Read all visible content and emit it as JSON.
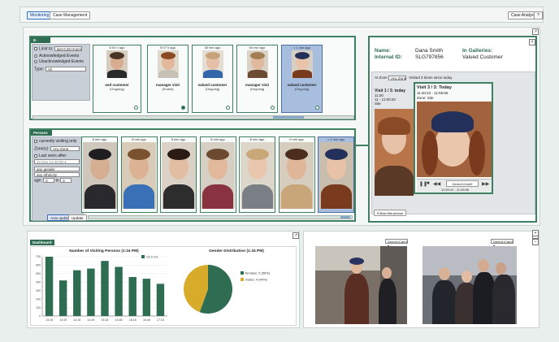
{
  "tabs": [
    {
      "label": "Monitoring"
    },
    {
      "label": "Case Management"
    }
  ],
  "top_right": {
    "case_analysis_label": "Case Analysis...",
    "help_label": "?"
  },
  "events": {
    "title": "E-Events",
    "limit_label": "Limit to:",
    "limit_value": "last 0.25 Hours",
    "filter_options": [
      "Acknowledged Events",
      "Unacknowledged Events"
    ],
    "type_label": "Type:",
    "type_value": "All",
    "cards": [
      {
        "time": "5:04 h ago",
        "label": "ued customer",
        "sub": "(Ongoing)"
      },
      {
        "time": "5:07 h ago",
        "label": "manager visit",
        "sub": "(Ended)"
      },
      {
        "time": "40 min ago",
        "label": "valued customer",
        "sub": "(Ongoing)"
      },
      {
        "time": "60 min ago",
        "label": "manager visit",
        "sub": "(Ongoing)"
      },
      {
        "time": "< 1 min ago",
        "label": "valued customer",
        "sub": "(Ongoing)"
      }
    ]
  },
  "persons": {
    "title": "Persons",
    "currently_visiting": "currently visiting only",
    "zones_label": "Zone(s):",
    "zones_value": "Any Zone",
    "last_seen_label": "Last seen after:",
    "date_value": "22 Nov 13 00:00 ▾",
    "gender_value": "any gender",
    "ethnicity_value": "any ethnicity",
    "age_label": "age:",
    "age_from": "0",
    "age_to_label": "to",
    "age_to": "0",
    "auto_update_label": "Auto update",
    "update_label": "Update",
    "cards": [
      {
        "time": "8 min ago"
      },
      {
        "time": "8 min ago"
      },
      {
        "time": "8 min ago"
      },
      {
        "time": "8 min ago"
      },
      {
        "time": "8 min ago"
      },
      {
        "time": "9 min ago"
      },
      {
        "time": "< 1 min ago"
      }
    ]
  },
  "detail": {
    "name_label": "Name:",
    "name_value": "Dana Smith",
    "id_label": "Internal ID:",
    "id_value": "SLG797856",
    "galleries_label": "In Galleries:",
    "galleries_value": "Valued Customer",
    "at_zone_label": "At Zone",
    "zone_value": "Any Zone",
    "visited_text": "Visited 3 times since today",
    "visit_title": "Visit 1 / 3: today",
    "visit_time": "11:00",
    "visit_range": "11 - 11:00:20",
    "visit_zone": "Site",
    "popup_title": "Visit 3 / 3: Today",
    "popup_time": "11:40:23 - 11:55:56",
    "popup_zone": "Zone: Site",
    "player_label": "Demo1\\Cam0",
    "player_time": "11:55:10 - 11:55:56",
    "follow_label": "Follow this person"
  },
  "dashboard": {
    "title": "Dashboard",
    "chart1_title": "Number of Visiting Persons (1:34 PM)",
    "chart2_title": "Gender Distribution (1:34 PM)",
    "bar_legend": "1/1:1+1/1"
  },
  "chart_data": [
    {
      "type": "bar",
      "title": "Number of Visiting Persons (1:34 PM)",
      "categories": [
        "13:18",
        "13:49",
        "14:18",
        "14:49",
        "15:18",
        "15:48",
        "16:18",
        "16:48",
        "17:18"
      ],
      "values": [
        760,
        420,
        540,
        560,
        650,
        580,
        460,
        440,
        380
      ],
      "ylim": [
        0,
        700
      ],
      "yticks": [
        0,
        100,
        200,
        300,
        400,
        500,
        600,
        700
      ],
      "color": "#2e6d52"
    },
    {
      "type": "pie",
      "title": "Gender Distribution (1:34 PM)",
      "slices": [
        {
          "label": "females",
          "value": 5,
          "pct": "56%",
          "color": "#2e6d52"
        },
        {
          "label": "males",
          "value": 4,
          "pct": "44%",
          "color": "#d8ac2a"
        }
      ]
    }
  ],
  "video": {
    "cam1_label": "Demo1\\Cam1 ▾",
    "cam2_label": "Demo1\\Cam2 ▾"
  },
  "colors": {
    "accent": "#2e6d52",
    "selected": "#a8bedf",
    "filter_bg": "#c8cfd6"
  }
}
